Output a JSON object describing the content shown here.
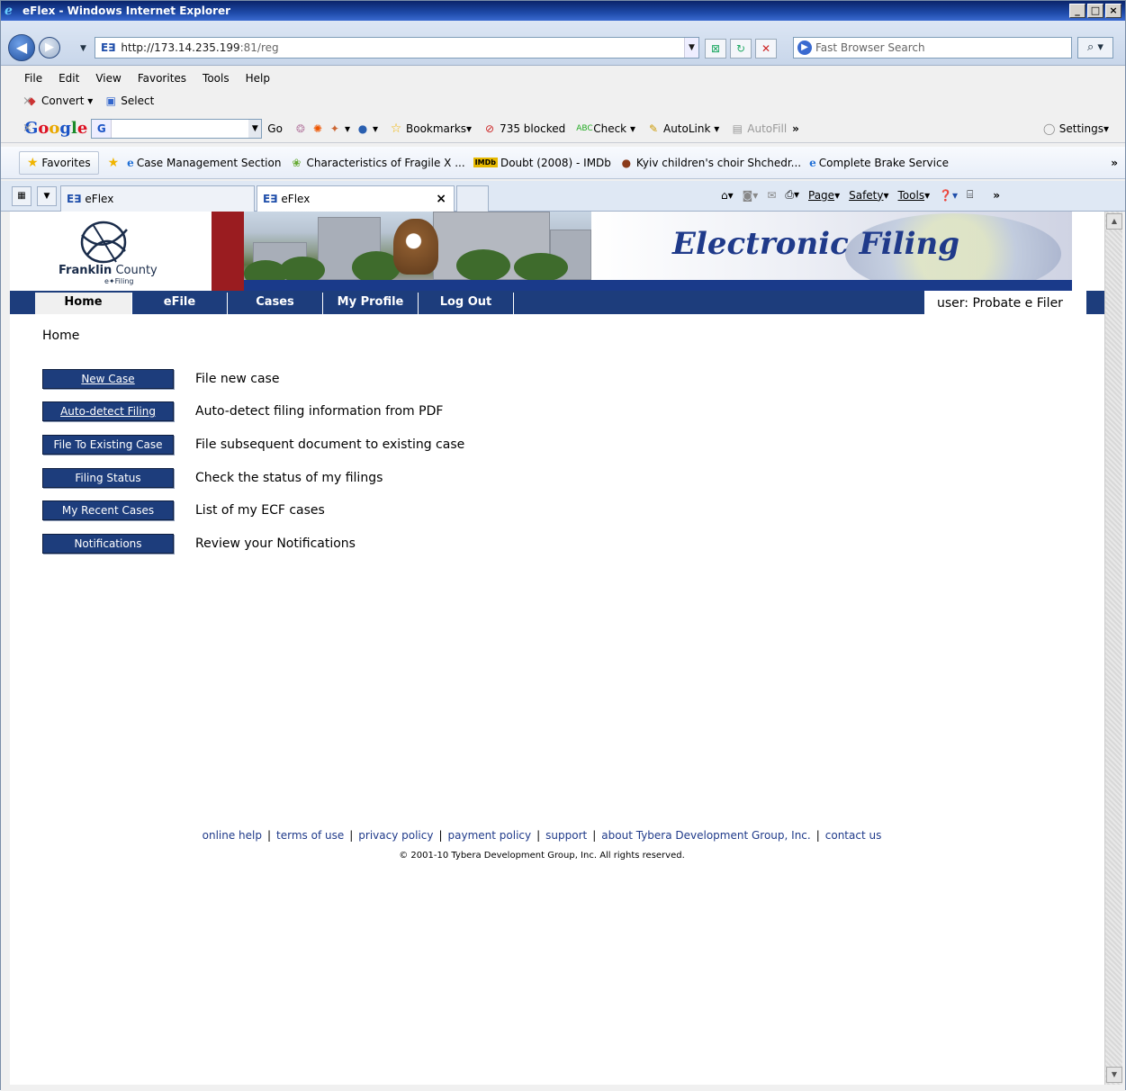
{
  "window": {
    "title": "eFlex - Windows Internet Explorer",
    "controls": {
      "minimize": "_",
      "maximize": "□",
      "close": "×"
    }
  },
  "address_bar": {
    "favicon": "E∃",
    "url_host": "http://173.14.235.199",
    "url_rest": ":81/reg",
    "search_placeholder": "Fast Browser Search"
  },
  "menu": [
    "File",
    "Edit",
    "View",
    "Favorites",
    "Tools",
    "Help"
  ],
  "toolbar1": {
    "convert": "Convert",
    "select": "Select"
  },
  "toolbar2": {
    "google_logo": "Google",
    "go": "Go",
    "bookmarks": "Bookmarks",
    "blocked": "735 blocked",
    "check": "Check",
    "autolink": "AutoLink",
    "autofill": "AutoFill",
    "more": "»",
    "settings": "Settings"
  },
  "favorites_bar": {
    "favorites_label": "Favorites",
    "items": [
      "Case Management Section",
      "Characteristics of Fragile X ...",
      "Doubt (2008) - IMDb",
      "Kyiv children's choir Shchedr...",
      "Complete Brake Service"
    ]
  },
  "tabs": [
    {
      "label": "eFlex"
    },
    {
      "label": "eFlex"
    }
  ],
  "command_bar": {
    "page": "Page",
    "safety": "Safety",
    "tools": "Tools"
  },
  "site": {
    "logo_main": "Franklin",
    "logo_county": "County",
    "logo_sub": "e✦Filing",
    "title": "Electronic Filing",
    "nav": [
      "Home",
      "eFile",
      "Cases",
      "My Profile",
      "Log Out"
    ],
    "user": "user: Probate e Filer",
    "breadcrumb": "Home"
  },
  "actions": [
    {
      "button": "New Case",
      "desc": "File new case"
    },
    {
      "button": "Auto-detect Filing",
      "desc": "Auto-detect filing information from PDF"
    },
    {
      "button": "File To Existing Case",
      "desc": "File subsequent document to existing case"
    },
    {
      "button": "Filing Status",
      "desc": "Check the status of my filings"
    },
    {
      "button": "My Recent Cases",
      "desc": "List of my ECF cases"
    },
    {
      "button": "Notifications",
      "desc": "Review your Notifications"
    }
  ],
  "footer": {
    "links": [
      "online help",
      "terms of use",
      "privacy policy",
      "payment policy",
      "support",
      "about Tybera Development Group, Inc.",
      "contact us"
    ],
    "separator": "|",
    "copyright": "© 2001-10 Tybera Development Group, Inc. All rights reserved."
  }
}
